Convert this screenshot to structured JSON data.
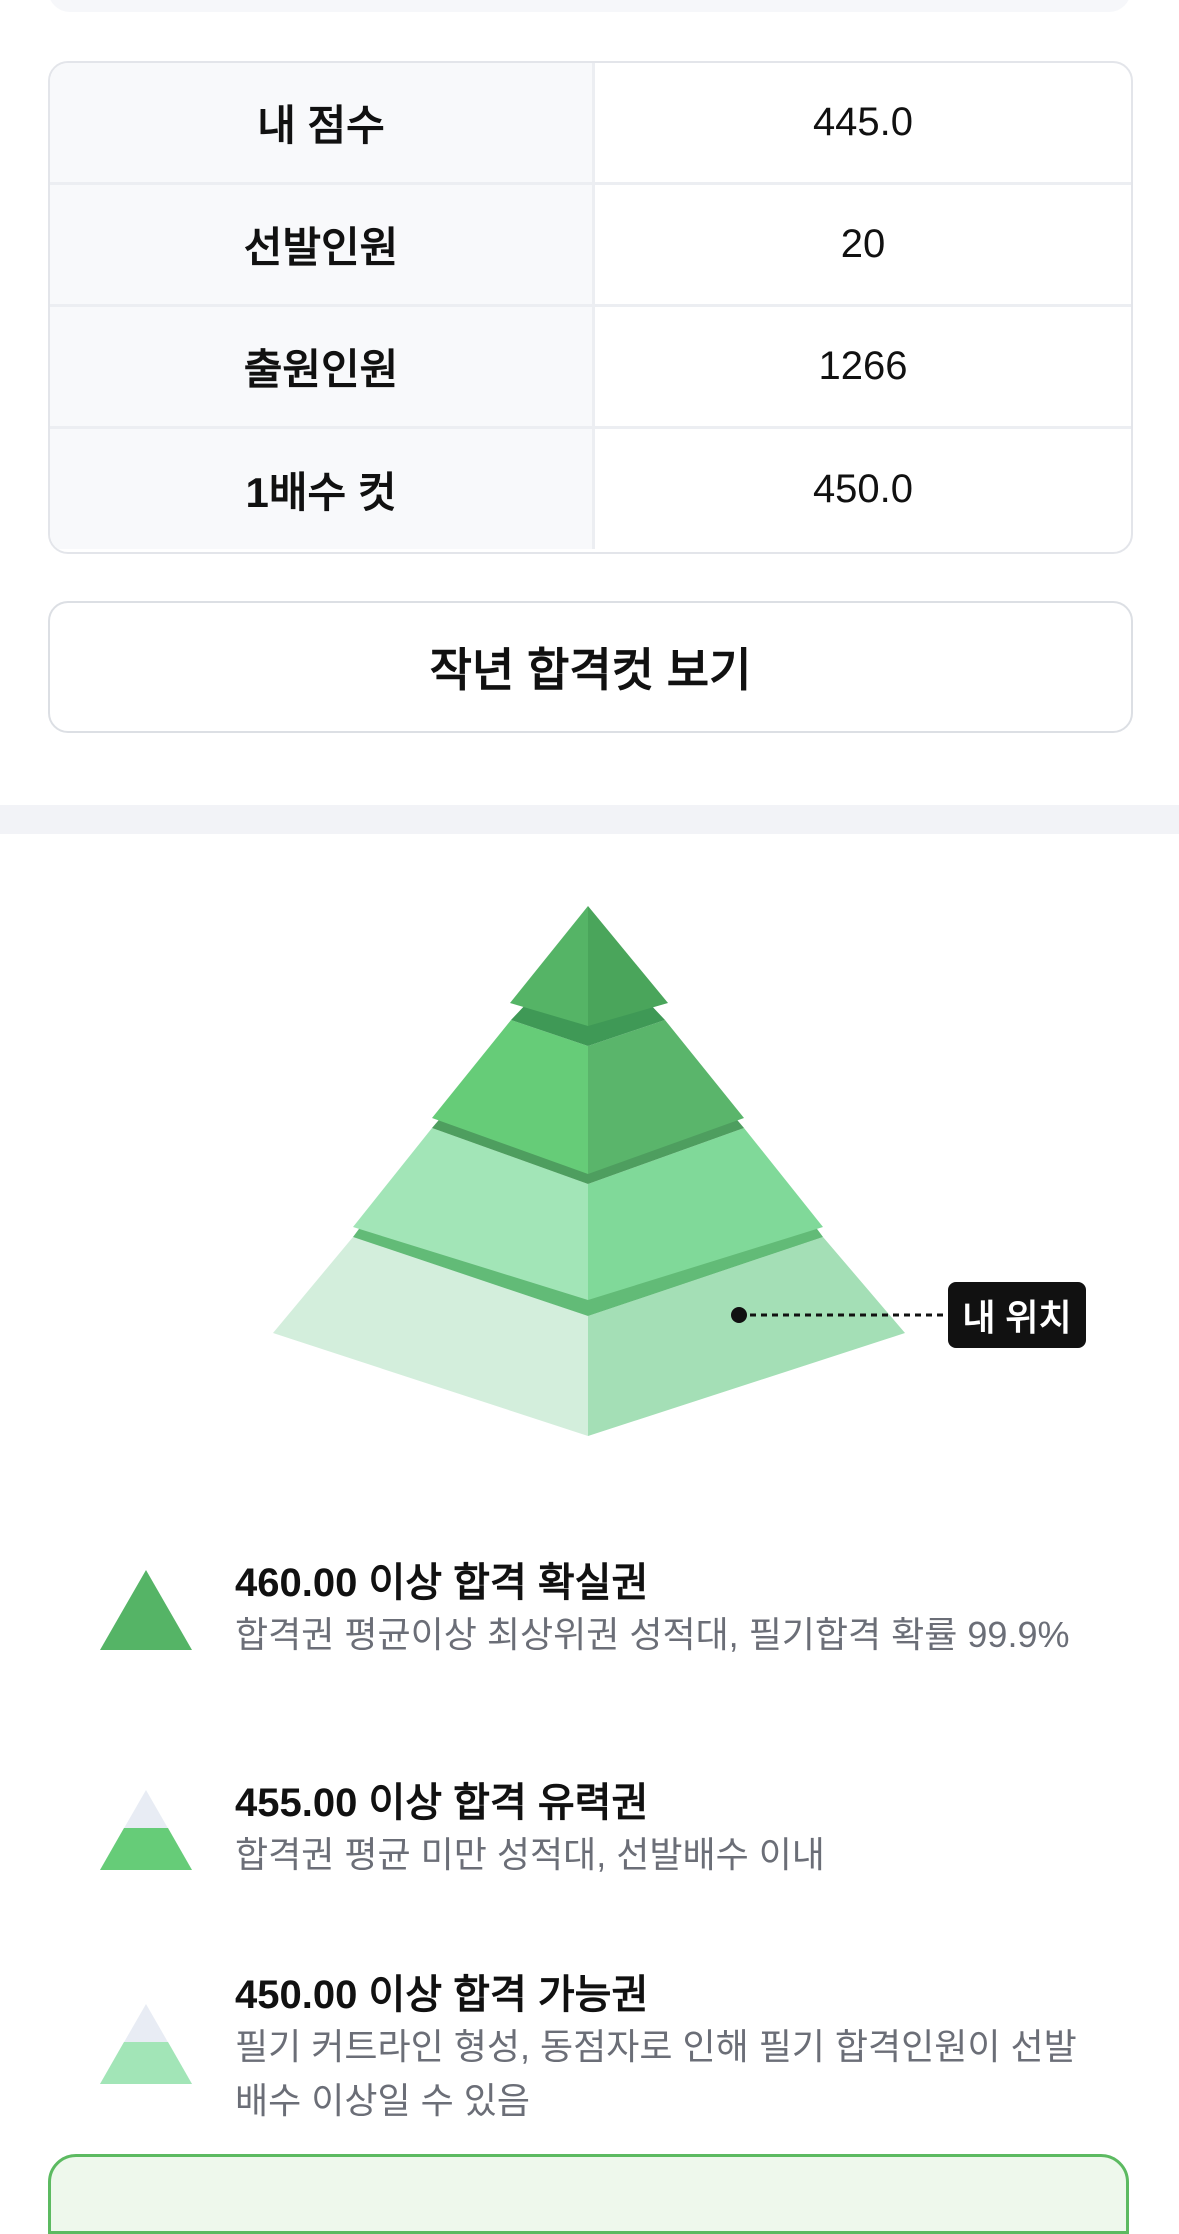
{
  "score_table": [
    {
      "label": "내 점수",
      "value": "445.0"
    },
    {
      "label": "선발인원",
      "value": "20"
    },
    {
      "label": "출원인원",
      "value": "1266"
    },
    {
      "label": "1배수 컷",
      "value": "450.0"
    }
  ],
  "last_year_button_label": "작년 합격컷 보기",
  "pyramid": {
    "my_position_label": "내 위치",
    "colors": {
      "tier1_left": "#55b466",
      "tier1_right": "#4aa55b",
      "tier2_left": "#66cc78",
      "tier2_right": "#5ab56b",
      "tier3_left": "#a2e5b7",
      "tier3_right": "#80d999",
      "tier4_left": "#d3eedc",
      "tier4_right": "#a4dfb6",
      "ring_dark": "#3f9956",
      "ring_mid": "#4e9e5f",
      "ring_light": "#62bb77"
    }
  },
  "legend": [
    {
      "title": "460.00 이상 합격 확실권",
      "desc": "합격권 평균이상 최상위권 성적대, 필기합격 확률 99.9%",
      "icon": "triangle-full-icon"
    },
    {
      "title": "455.00 이상 합격 유력권",
      "desc": "합격권 평균 미만 성적대, 선발배수 이내",
      "icon": "triangle-mid-icon"
    },
    {
      "title": "450.00 이상 합격 가능권",
      "desc": "필기 커트라인 형성, 동점자로 인해 필기 합격인원이 선발배수 이상일 수 있음",
      "icon": "triangle-low-icon"
    }
  ]
}
